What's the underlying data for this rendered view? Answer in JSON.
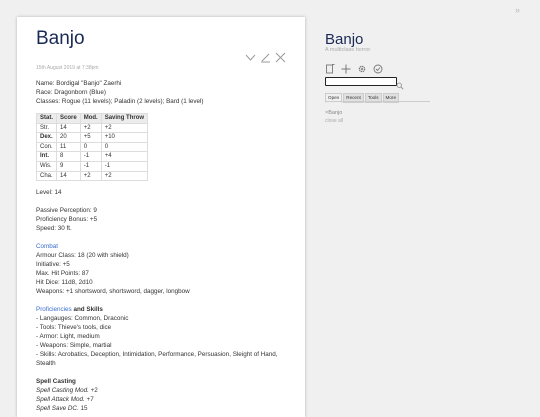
{
  "tiddler": {
    "title": "Banjo",
    "date": "15th August 2019 at 7:38pm",
    "lines_top": [
      "Name: Bordigal \"Banjo\" Zaerhi",
      "Race: Dragonborn (Blue)",
      "Classes: Rogue (11 levels); Paladin (2 levels); Bard (1 level)"
    ],
    "stats_headers": [
      "Stat.",
      "Score",
      "Mod.",
      "Saving Throw"
    ],
    "stats_rows": [
      [
        "Str.",
        "14",
        "+2",
        "+2"
      ],
      [
        "Dex.",
        "20",
        "+5",
        "+10"
      ],
      [
        "Con.",
        "11",
        "0",
        "0"
      ],
      [
        "Int.",
        "8",
        "-1",
        "+4"
      ],
      [
        "Wis.",
        "9",
        "-1",
        "-1"
      ],
      [
        "Cha.",
        "14",
        "+2",
        "+2"
      ]
    ],
    "level": "Level: 14",
    "passive": "Passive Perception: 9",
    "prof_bonus": "Proficiency Bonus: +5",
    "speed": "Speed: 30 ft.",
    "combat_link": "Combat",
    "combat_lines": [
      "Armour Class: 18 (20 with shield)",
      "Initiative: +5",
      "Max. Hit Points: 87",
      "Hit Dice: 11d8, 2d10",
      "Weapons: +1 shortsword, shortsword, dagger, longbow"
    ],
    "prof_link": "Proficiencies",
    "prof_and": " and Skills",
    "prof_lines": [
      "- Langauges: Common, Draconic",
      "- Tools: Thieve's tools, dice",
      "- Armor: Light, medium",
      "- Weapons: Simple, martial",
      "- Skills: Acrobatics, Deception, Intimidation, Performance, Persuasion, Sleight of Hand, Stealth"
    ],
    "spell_heading": "Spell Casting",
    "spell_lines": [
      {
        "label": "Spell Casting Mod.",
        "value": " +2"
      },
      {
        "label": "Spell Attack Mod.",
        "value": " +7"
      },
      {
        "label": "Spell Save DC.",
        "value": " 15"
      }
    ]
  },
  "sidebar": {
    "title": "Banjo",
    "subtitle": "A multiclass horror",
    "tabs": [
      "Open",
      "Recent",
      "Tools",
      "More"
    ],
    "open_item": "×Banjo",
    "close_all": "close all"
  },
  "icons": {
    "more": "chevron-down-icon",
    "edit": "pencil-icon",
    "close": "close-icon",
    "new": "new-tiddler-icon",
    "plus": "plus-icon",
    "control": "gear-icon",
    "save": "save-icon",
    "search": "search-icon",
    "toggle": "double-chevron-right-icon"
  },
  "colors": {
    "title": "#1a2a55",
    "link": "#3a6ccc",
    "bg": "#f0f0f0"
  }
}
